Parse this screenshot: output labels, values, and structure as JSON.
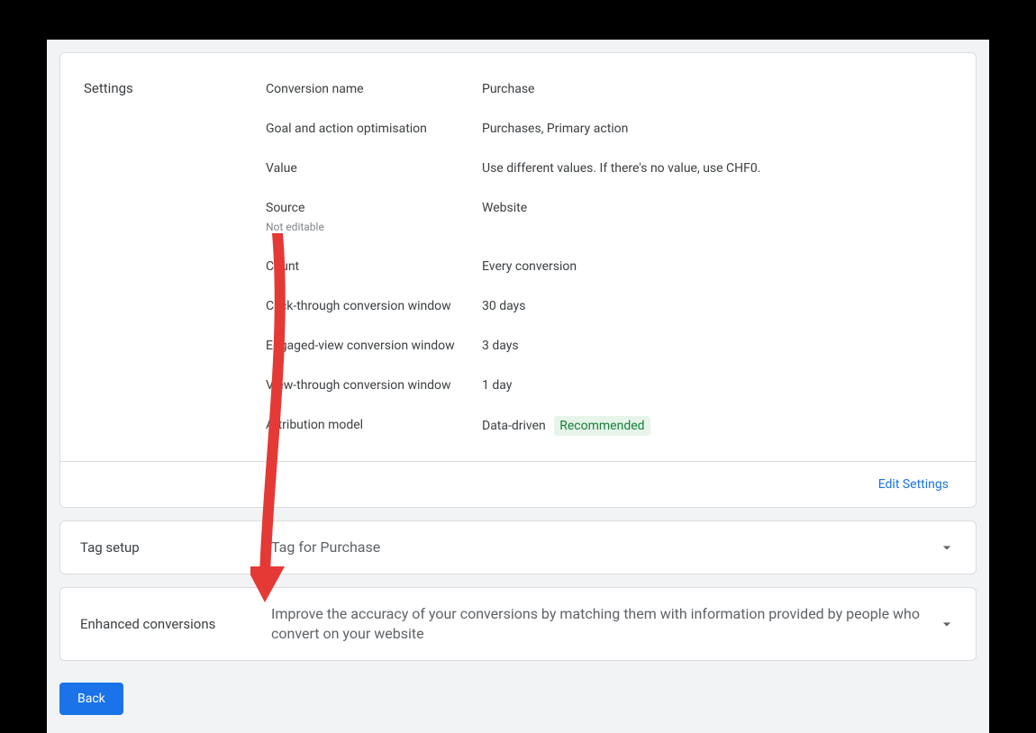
{
  "settings": {
    "title": "Settings",
    "rows": {
      "conversion_name": {
        "label": "Conversion name",
        "value": "Purchase"
      },
      "goal": {
        "label": "Goal and action optimisation",
        "value": "Purchases, Primary action"
      },
      "value": {
        "label": "Value",
        "value": "Use different values. If there's no value, use CHF0."
      },
      "source": {
        "label": "Source",
        "sublabel": "Not editable",
        "value": "Website"
      },
      "count": {
        "label": "Count",
        "value": "Every conversion"
      },
      "click_window": {
        "label": "Click-through conversion window",
        "value": "30 days"
      },
      "engaged_window": {
        "label": "Engaged-view conversion window",
        "value": "3 days"
      },
      "view_window": {
        "label": "View-through conversion window",
        "value": "1 day"
      },
      "attribution": {
        "label": "Attribution model",
        "value": "Data-driven",
        "badge": "Recommended"
      }
    },
    "edit_link": "Edit Settings"
  },
  "tag_setup": {
    "title": "Tag setup",
    "desc": "Tag for Purchase"
  },
  "enhanced": {
    "title": "Enhanced conversions",
    "desc": "Improve the accuracy of your conversions by matching them with information provided by people who convert on your website"
  },
  "back_button": "Back"
}
